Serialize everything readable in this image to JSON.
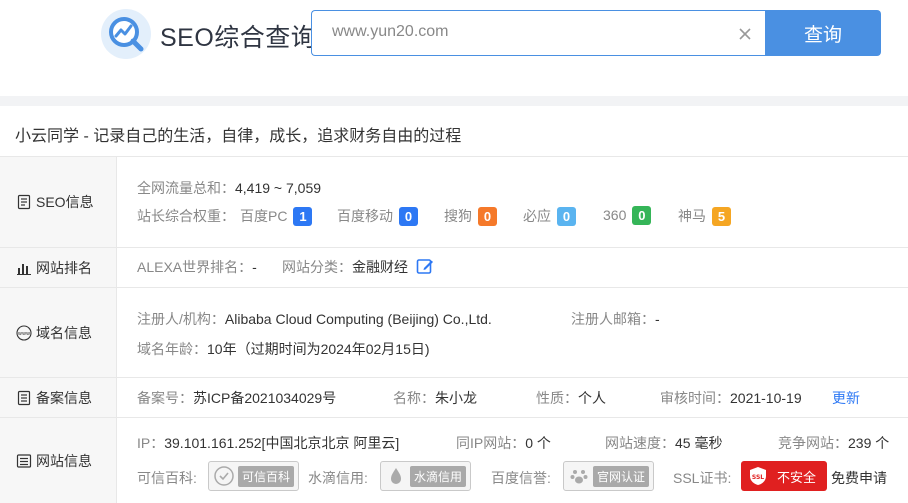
{
  "header": {
    "logo_text": "SEO综合查询",
    "search_value": "www.yun20.com",
    "search_button": "查询"
  },
  "site_title": "小云同学 - 记录自己的生活，自律，成长，追求财务自由的过程",
  "seo": {
    "label": "SEO信息",
    "traffic_label": "全网流量总和：",
    "traffic_value": "4,419 ~ 7,059",
    "weight_label": "站长综合权重：",
    "engines": [
      {
        "name": "百度PC",
        "value": "1",
        "color": "#2d78f4"
      },
      {
        "name": "百度移动",
        "value": "0",
        "color": "#2d78f4"
      },
      {
        "name": "搜狗",
        "value": "0",
        "color": "#f5792a"
      },
      {
        "name": "必应",
        "value": "0",
        "color": "#5ab4f0"
      },
      {
        "name": "360",
        "value": "0",
        "color": "#35b558"
      },
      {
        "name": "神马",
        "value": "5",
        "color": "#f5a623"
      }
    ]
  },
  "rank": {
    "label": "网站排名",
    "alexa_label": "ALEXA世界排名：",
    "alexa_value": "-",
    "category_label": "网站分类：",
    "category_value": "金融财经"
  },
  "domain": {
    "label": "域名信息",
    "registrant_label": "注册人/机构：",
    "registrant_value": "Alibaba Cloud Computing (Beijing) Co.,Ltd.",
    "email_label": "注册人邮箱：",
    "email_value": "-",
    "age_label": "域名年龄：",
    "age_value": "10年（过期时间为2024年02月15日)"
  },
  "icp": {
    "label": "备案信息",
    "number_label": "备案号：",
    "number_value": "苏ICP备2021034029号",
    "name_label": "名称：",
    "name_value": "朱小龙",
    "type_label": "性质：",
    "type_value": "个人",
    "audit_label": "审核时间：",
    "audit_value": "2021-10-19",
    "update_link": "更新"
  },
  "siteinfo": {
    "label": "网站信息",
    "ip_label": "IP：",
    "ip_value": "39.101.161.252[中国北京北京 阿里云]",
    "sameip_label": "同IP网站：",
    "sameip_value": "0 个",
    "speed_label": "网站速度：",
    "speed_value": "45 毫秒",
    "compete_label": "竞争网站：",
    "compete_value": "239 个",
    "kexin_label": "可信百科:",
    "kexin_badge": "可信百科",
    "shuidi_label": "水滴信用:",
    "shuidi_badge": "水滴信用",
    "baidu_label": "百度信誉:",
    "baidu_badge": "官网认证",
    "ssl_label": "SSL证书:",
    "ssl_badge": "不安全",
    "ssl_icon_text": "SSL",
    "ssl_link": "免费申请"
  }
}
